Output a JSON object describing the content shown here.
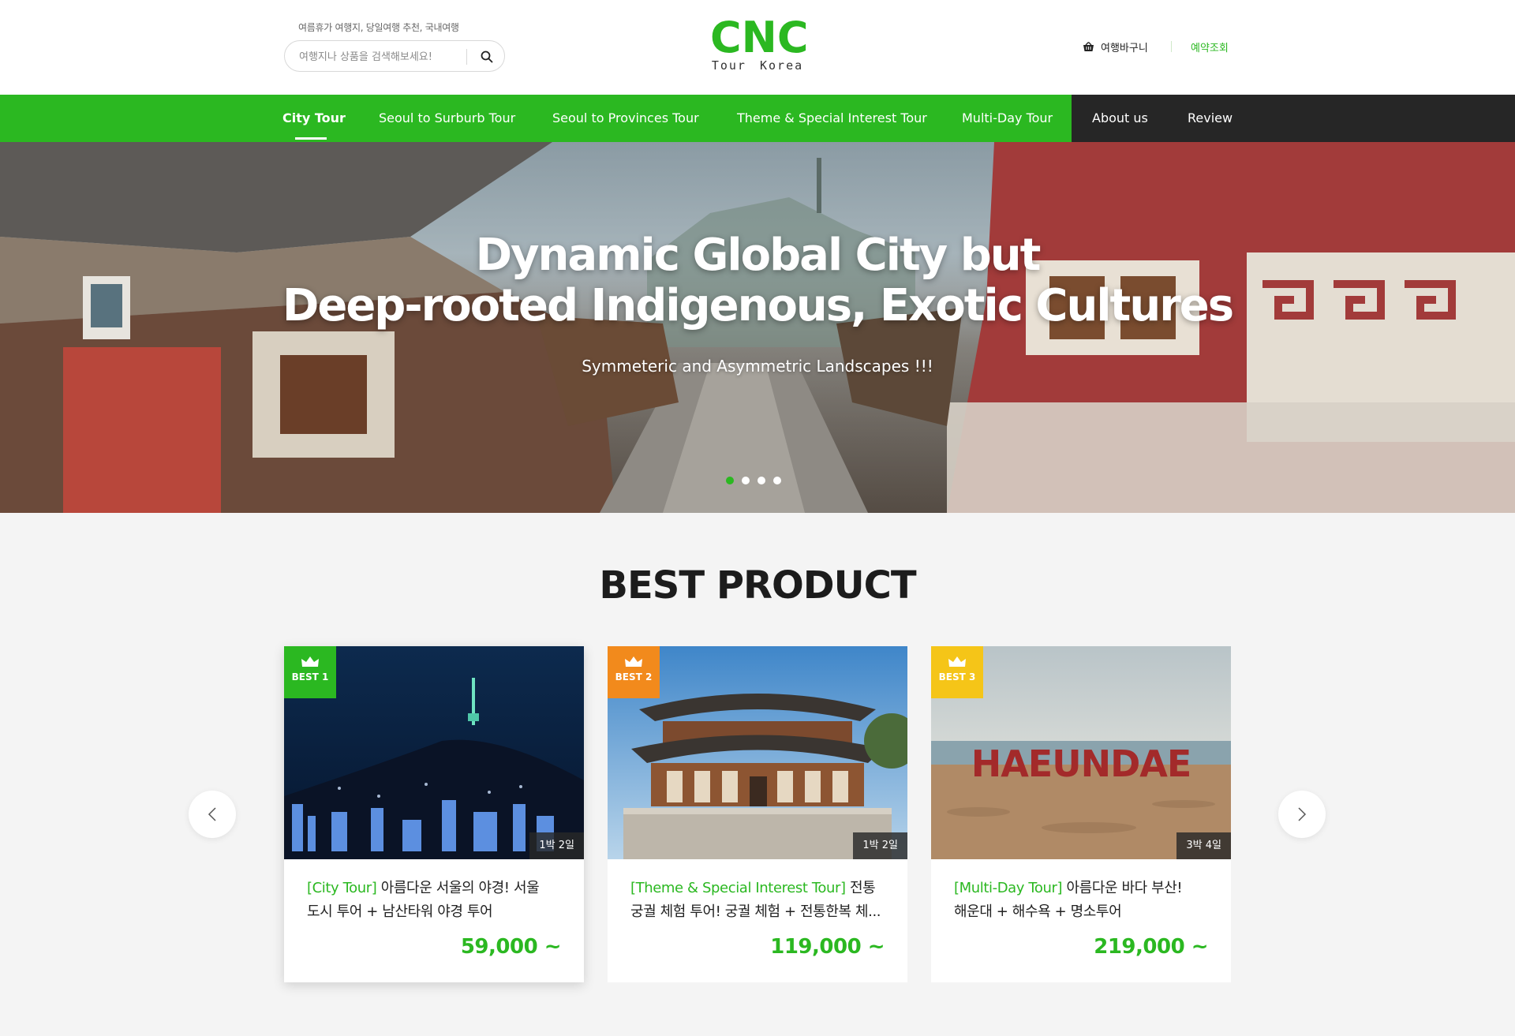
{
  "header": {
    "tagline": "여름휴가 여행지, 당일여행 추천, 국내여행",
    "search_placeholder": "여행지나 상품을 검색해보세요!",
    "logo_main": "CNC",
    "logo_sub": "Tour Korea",
    "cart_label": "여행바구니",
    "reserve_label": "예약조회"
  },
  "nav": {
    "items": [
      {
        "label": "City Tour",
        "active": true
      },
      {
        "label": "Seoul to Surburb Tour"
      },
      {
        "label": "Seoul to Provinces Tour"
      },
      {
        "label": "Theme & Special Interest Tour"
      },
      {
        "label": "Multi-Day Tour"
      },
      {
        "label": "About us"
      },
      {
        "label": "Review"
      }
    ]
  },
  "hero": {
    "title_line1": "Dynamic Global City but",
    "title_line2": "Deep-rooted Indigenous, Exotic Cultures",
    "subtitle": "Symmeteric and Asymmetric Landscapes !!!",
    "slide_count": 4,
    "active_slide": 1
  },
  "best": {
    "title": "BEST PRODUCT",
    "products": [
      {
        "badge": "BEST 1",
        "badge_color": "#2bb821",
        "duration": "1박 2일",
        "category": "[City Tour]",
        "title_line1": " 아름다운 서울의 야경! 서울",
        "title_line2": "도시 투어 + 남산타워 야경 투어",
        "price": "59,000 ~"
      },
      {
        "badge": "BEST 2",
        "badge_color": "#f28a1c",
        "duration": "1박 2일",
        "category": "[Theme & Special Interest Tour]",
        "title_line1": " 전통",
        "title_line2": "궁궐 체험 투어! 궁궐 체험 + 전통한복 체...",
        "price": "119,000 ~"
      },
      {
        "badge": "BEST 3",
        "badge_color": "#f5c518",
        "duration": "3박 4일",
        "category": "[Multi-Day Tour]",
        "title_line1": " 아름다운 바다 부산!",
        "title_line2": "해운대 + 해수욕 + 명소투어",
        "price": "219,000 ~"
      }
    ],
    "image_text_3": "HAEUNDAE"
  },
  "colors": {
    "brand": "#2bb821",
    "nav_dark": "#262626"
  }
}
